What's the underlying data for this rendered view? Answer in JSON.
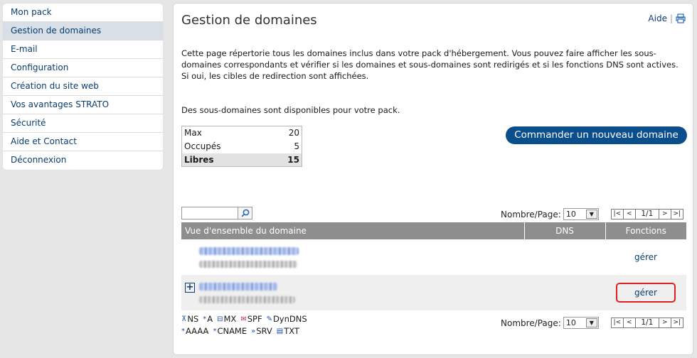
{
  "sidebar": {
    "items": [
      {
        "label": "Mon pack"
      },
      {
        "label": "Gestion de domaines"
      },
      {
        "label": "E-mail"
      },
      {
        "label": "Configuration"
      },
      {
        "label": "Création du site web"
      },
      {
        "label": "Vos avantages STRATO"
      },
      {
        "label": "Sécurité"
      },
      {
        "label": "Aide et Contact"
      },
      {
        "label": "Déconnexion"
      }
    ]
  },
  "main": {
    "title": "Gestion de domaines",
    "help_label": "Aide",
    "help_separator": "|",
    "intro_text": "Cette page répertorie tous les domaines inclus dans votre pack d'hébergement. Vous pouvez faire afficher les sous-domaines correspondants et vérifier si les domaines et sous-domaines sont redirigés et si les fonctions DNS sont actives. Si oui, les cibles de redirection sont affichées.",
    "subdomain_info": "Des sous-domaines sont disponibles pour votre pack."
  },
  "quota": {
    "rows": [
      {
        "label": "Max",
        "value": "20"
      },
      {
        "label": "Occupés",
        "value": "5"
      },
      {
        "label": "Libres",
        "value": "15"
      }
    ]
  },
  "order_button_label": "Commander un nouveau domaine",
  "search": {
    "value": "",
    "placeholder": ""
  },
  "pagination": {
    "per_page_label": "Nombre/Page:",
    "per_page_value": "10",
    "page_info": "1/1",
    "first": "|<",
    "prev": "<",
    "next": ">",
    "last": ">|"
  },
  "domain_table": {
    "headers": {
      "overview": "Vue d'ensemble du domaine",
      "dns": "DNS",
      "functions": "Fonctions"
    },
    "rows": [
      {
        "action": "gérer"
      },
      {
        "action": "gérer",
        "expand": "+"
      }
    ]
  },
  "legend": {
    "row1": [
      {
        "icon": "ns-icon",
        "glyph": "⊼",
        "label": "NS"
      },
      {
        "icon": "a-record-icon",
        "glyph": "*",
        "label": "A"
      },
      {
        "icon": "mx-icon",
        "glyph": "⊟",
        "label": "MX"
      },
      {
        "icon": "spf-icon",
        "glyph": "✉",
        "label": "SPF"
      },
      {
        "icon": "dyndns-icon",
        "glyph": "✎",
        "label": "DynDNS"
      }
    ],
    "row2": [
      {
        "icon": "aaaa-icon",
        "glyph": "*",
        "label": "AAAA"
      },
      {
        "icon": "cname-icon",
        "glyph": "*",
        "label": "CNAME"
      },
      {
        "icon": "srv-icon",
        "glyph": "»",
        "label": "SRV"
      },
      {
        "icon": "txt-icon",
        "glyph": "▤",
        "label": "TXT"
      }
    ]
  },
  "colors": {
    "accent": "#0a4e8c",
    "link": "#0a3d6e",
    "highlight_border": "#e02020",
    "table_header": "#8e8e8e"
  }
}
